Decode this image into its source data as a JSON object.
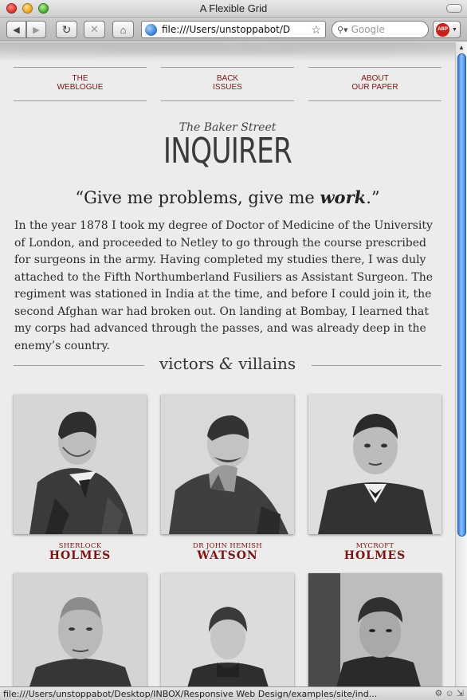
{
  "window": {
    "title": "A Flexible Grid"
  },
  "toolbar": {
    "url": "file:///Users/unstoppabot/D",
    "search_placeholder": "Google",
    "abp_label": "ABP"
  },
  "nav": [
    {
      "line1": "The",
      "line2": "Weblogue"
    },
    {
      "line1": "Back",
      "line2": "Issues"
    },
    {
      "line1": "About",
      "line2": "Our Paper"
    }
  ],
  "masthead": {
    "top": "The Baker Street",
    "main": "INQUIRER"
  },
  "quote": {
    "before": "“Give me problems, give me ",
    "emph": "work",
    "after": ".”"
  },
  "body": "In the year 1878 I took my degree of Doctor of Medicine of the University of London, and proceeded to Netley to go through the course prescribed for surgeons in the army. Having completed my studies there, I was duly attached to the Fifth Northumberland Fusiliers as Assistant Surgeon. The regiment was stationed in India at the time, and before I could join it, the second Afghan war had broken out. On landing at Bombay, I learned that my corps had advanced through the passes, and was already deep in the enemy’s country.",
  "section": {
    "left": "victors ",
    "amp": "&",
    "right": " villains"
  },
  "figures": [
    {
      "first": "Sherlock",
      "last": "Holmes"
    },
    {
      "first": "Dr John Hemish",
      "last": "Watson"
    },
    {
      "first": "Mycroft",
      "last": "Holmes"
    }
  ],
  "status": {
    "text": "file:///Users/unstoppabot/Desktop/INBOX/Responsive Web Design/examples/site/ind..."
  },
  "colors": {
    "accent": "#7d1413",
    "page_bg": "#ececec"
  }
}
